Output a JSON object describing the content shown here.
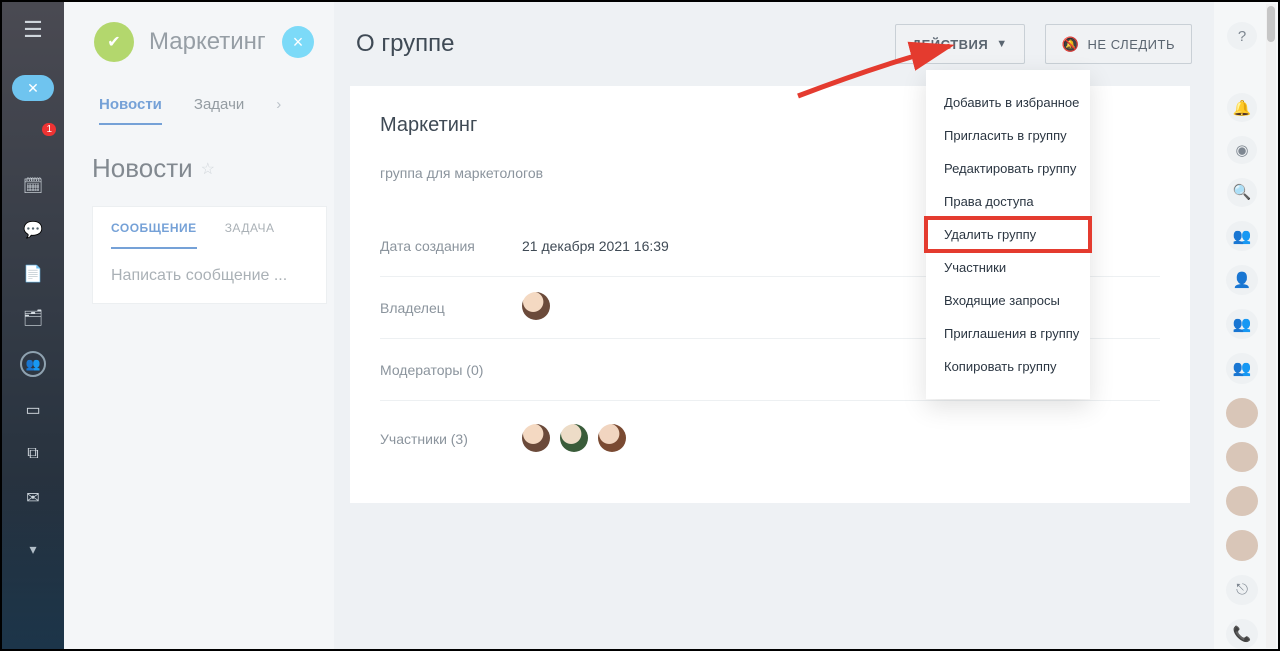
{
  "leftnav": {
    "badge": "1"
  },
  "group": {
    "name": "Маркетинг",
    "tabs": {
      "news": "Новости",
      "tasks": "Задачи"
    },
    "newsHeading": "Новости",
    "compose": {
      "tabMessage": "СООБЩЕНИЕ",
      "tabTask": "ЗАДАЧА",
      "placeholder": "Написать сообщение ..."
    }
  },
  "panel": {
    "title": "О группе",
    "actionsBtn": "ДЕЙСТВИЯ",
    "unfollowBtn": "НЕ СЛЕДИТЬ",
    "card": {
      "name": "Маркетинг",
      "desc": "группа для маркетологов",
      "createdLabel": "Дата создания",
      "createdValue": "21 декабря 2021 16:39",
      "ownerLabel": "Владелец",
      "moderatorsLabel": "Модераторы (0)",
      "membersLabel": "Участники (3)"
    }
  },
  "menu": {
    "items": [
      "Добавить в избранное",
      "Пригласить в группу",
      "Редактировать группу",
      "Права доступа",
      "Удалить группу",
      "Участники",
      "Входящие запросы",
      "Приглашения в группу",
      "Копировать группу"
    ],
    "highlightIndex": 4
  }
}
